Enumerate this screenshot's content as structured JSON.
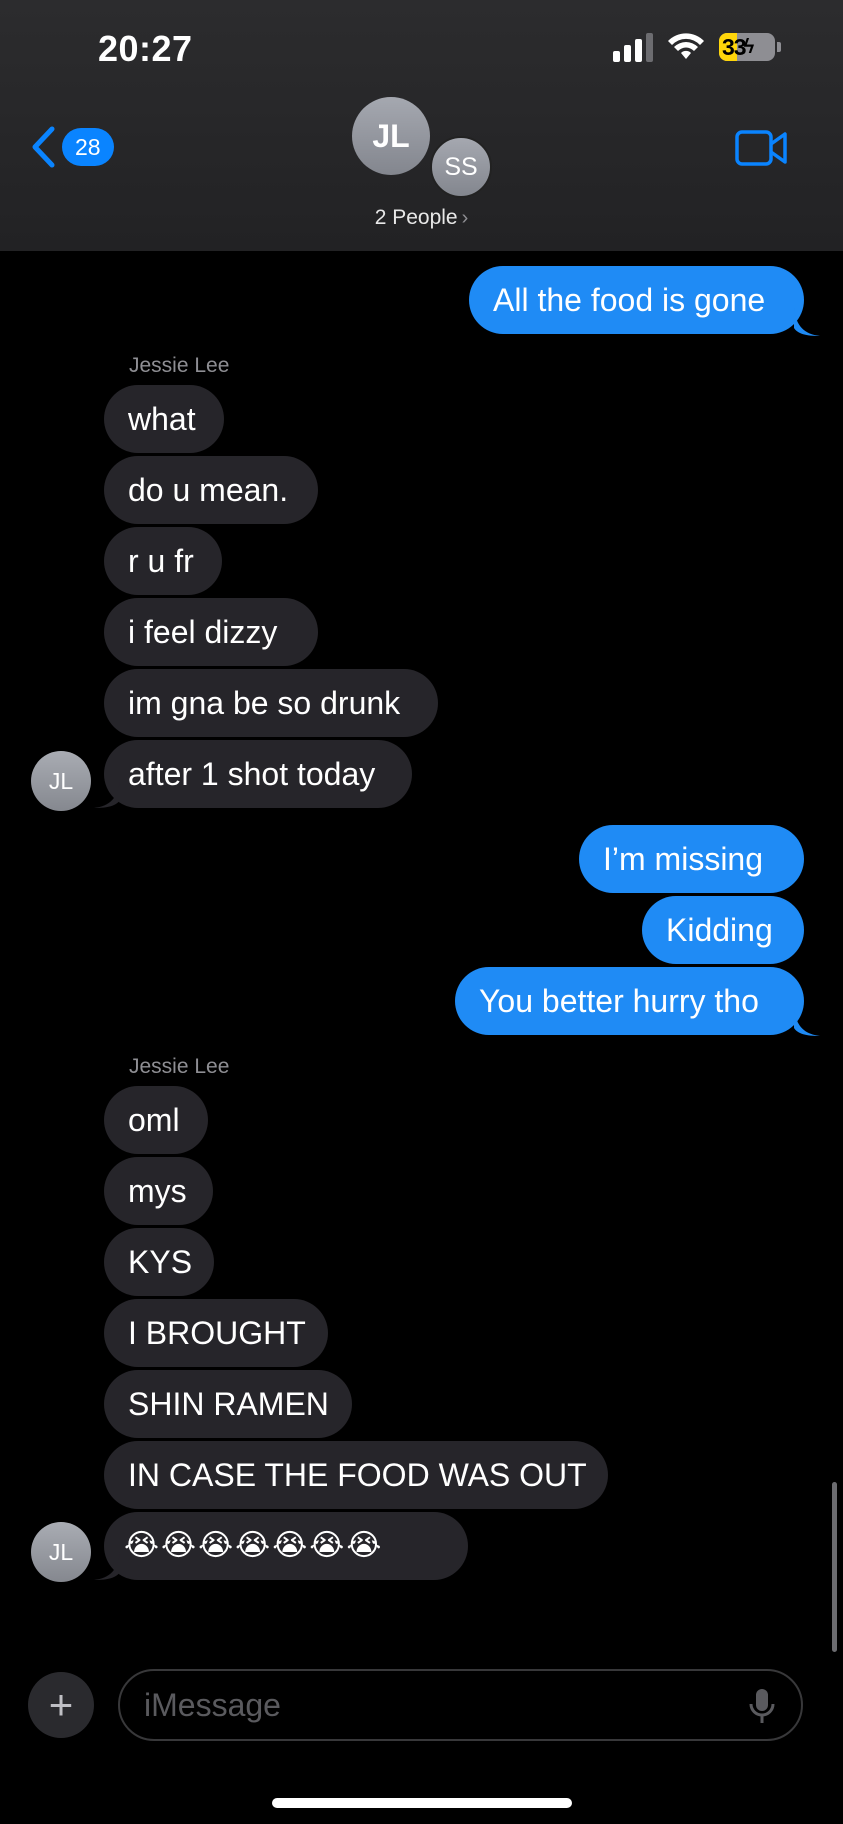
{
  "status_bar": {
    "time": "20:27",
    "battery": "33",
    "icons": [
      "signal-icon",
      "wifi-icon",
      "battery-charging-icon"
    ]
  },
  "nav": {
    "back_count": "28",
    "avatar_primary": "JL",
    "avatar_secondary": "SS",
    "people_label": "2 People",
    "video_icon": "video-camera-icon"
  },
  "messages": [
    {
      "dir": "out",
      "text": "All the food is gone"
    },
    {
      "dir": "in",
      "sender": "Jessie Lee",
      "text": "what"
    },
    {
      "dir": "in",
      "text": "do u mean."
    },
    {
      "dir": "in",
      "text": "r u fr"
    },
    {
      "dir": "in",
      "text": "i feel dizzy"
    },
    {
      "dir": "in",
      "text": "im gna be so drunk"
    },
    {
      "dir": "in",
      "text": "after 1 shot today",
      "avatar": "JL"
    },
    {
      "dir": "out",
      "text": "I’m missing"
    },
    {
      "dir": "out",
      "text": "Kidding"
    },
    {
      "dir": "out",
      "text": "You better hurry tho"
    },
    {
      "dir": "in",
      "sender": "Jessie Lee",
      "text": "oml"
    },
    {
      "dir": "in",
      "text": "mys"
    },
    {
      "dir": "in",
      "text": "KYS"
    },
    {
      "dir": "in",
      "text": "I BROUGHT"
    },
    {
      "dir": "in",
      "text": "SHIN RAMEN"
    },
    {
      "dir": "in",
      "text": "IN CASE THE FOOD WAS OUT"
    },
    {
      "dir": "in",
      "text": "😭😭😭😭😭😭😭",
      "avatar": "JL"
    }
  ],
  "compose": {
    "placeholder": "iMessage",
    "plus_label": "+",
    "icons": [
      "plus-icon",
      "microphone-icon"
    ]
  },
  "colors": {
    "outgoing": "#1f8bf5",
    "incoming": "#26252a",
    "accent": "#0a84ff"
  }
}
